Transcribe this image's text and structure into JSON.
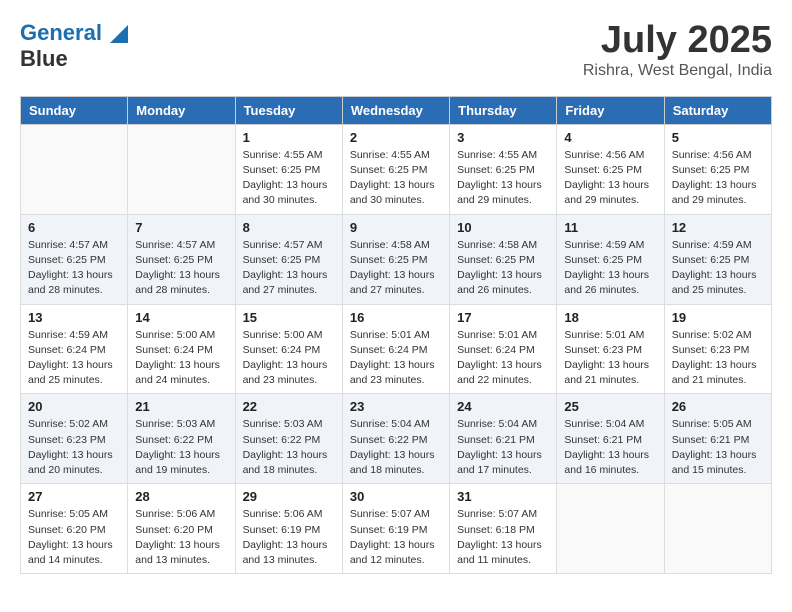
{
  "header": {
    "logo_line1": "General",
    "logo_line2": "Blue",
    "month_year": "July 2025",
    "location": "Rishra, West Bengal, India"
  },
  "weekdays": [
    "Sunday",
    "Monday",
    "Tuesday",
    "Wednesday",
    "Thursday",
    "Friday",
    "Saturday"
  ],
  "weeks": [
    [
      {
        "day": "",
        "info": ""
      },
      {
        "day": "",
        "info": ""
      },
      {
        "day": "1",
        "info": "Sunrise: 4:55 AM\nSunset: 6:25 PM\nDaylight: 13 hours and 30 minutes."
      },
      {
        "day": "2",
        "info": "Sunrise: 4:55 AM\nSunset: 6:25 PM\nDaylight: 13 hours and 30 minutes."
      },
      {
        "day": "3",
        "info": "Sunrise: 4:55 AM\nSunset: 6:25 PM\nDaylight: 13 hours and 29 minutes."
      },
      {
        "day": "4",
        "info": "Sunrise: 4:56 AM\nSunset: 6:25 PM\nDaylight: 13 hours and 29 minutes."
      },
      {
        "day": "5",
        "info": "Sunrise: 4:56 AM\nSunset: 6:25 PM\nDaylight: 13 hours and 29 minutes."
      }
    ],
    [
      {
        "day": "6",
        "info": "Sunrise: 4:57 AM\nSunset: 6:25 PM\nDaylight: 13 hours and 28 minutes."
      },
      {
        "day": "7",
        "info": "Sunrise: 4:57 AM\nSunset: 6:25 PM\nDaylight: 13 hours and 28 minutes."
      },
      {
        "day": "8",
        "info": "Sunrise: 4:57 AM\nSunset: 6:25 PM\nDaylight: 13 hours and 27 minutes."
      },
      {
        "day": "9",
        "info": "Sunrise: 4:58 AM\nSunset: 6:25 PM\nDaylight: 13 hours and 27 minutes."
      },
      {
        "day": "10",
        "info": "Sunrise: 4:58 AM\nSunset: 6:25 PM\nDaylight: 13 hours and 26 minutes."
      },
      {
        "day": "11",
        "info": "Sunrise: 4:59 AM\nSunset: 6:25 PM\nDaylight: 13 hours and 26 minutes."
      },
      {
        "day": "12",
        "info": "Sunrise: 4:59 AM\nSunset: 6:25 PM\nDaylight: 13 hours and 25 minutes."
      }
    ],
    [
      {
        "day": "13",
        "info": "Sunrise: 4:59 AM\nSunset: 6:24 PM\nDaylight: 13 hours and 25 minutes."
      },
      {
        "day": "14",
        "info": "Sunrise: 5:00 AM\nSunset: 6:24 PM\nDaylight: 13 hours and 24 minutes."
      },
      {
        "day": "15",
        "info": "Sunrise: 5:00 AM\nSunset: 6:24 PM\nDaylight: 13 hours and 23 minutes."
      },
      {
        "day": "16",
        "info": "Sunrise: 5:01 AM\nSunset: 6:24 PM\nDaylight: 13 hours and 23 minutes."
      },
      {
        "day": "17",
        "info": "Sunrise: 5:01 AM\nSunset: 6:24 PM\nDaylight: 13 hours and 22 minutes."
      },
      {
        "day": "18",
        "info": "Sunrise: 5:01 AM\nSunset: 6:23 PM\nDaylight: 13 hours and 21 minutes."
      },
      {
        "day": "19",
        "info": "Sunrise: 5:02 AM\nSunset: 6:23 PM\nDaylight: 13 hours and 21 minutes."
      }
    ],
    [
      {
        "day": "20",
        "info": "Sunrise: 5:02 AM\nSunset: 6:23 PM\nDaylight: 13 hours and 20 minutes."
      },
      {
        "day": "21",
        "info": "Sunrise: 5:03 AM\nSunset: 6:22 PM\nDaylight: 13 hours and 19 minutes."
      },
      {
        "day": "22",
        "info": "Sunrise: 5:03 AM\nSunset: 6:22 PM\nDaylight: 13 hours and 18 minutes."
      },
      {
        "day": "23",
        "info": "Sunrise: 5:04 AM\nSunset: 6:22 PM\nDaylight: 13 hours and 18 minutes."
      },
      {
        "day": "24",
        "info": "Sunrise: 5:04 AM\nSunset: 6:21 PM\nDaylight: 13 hours and 17 minutes."
      },
      {
        "day": "25",
        "info": "Sunrise: 5:04 AM\nSunset: 6:21 PM\nDaylight: 13 hours and 16 minutes."
      },
      {
        "day": "26",
        "info": "Sunrise: 5:05 AM\nSunset: 6:21 PM\nDaylight: 13 hours and 15 minutes."
      }
    ],
    [
      {
        "day": "27",
        "info": "Sunrise: 5:05 AM\nSunset: 6:20 PM\nDaylight: 13 hours and 14 minutes."
      },
      {
        "day": "28",
        "info": "Sunrise: 5:06 AM\nSunset: 6:20 PM\nDaylight: 13 hours and 13 minutes."
      },
      {
        "day": "29",
        "info": "Sunrise: 5:06 AM\nSunset: 6:19 PM\nDaylight: 13 hours and 13 minutes."
      },
      {
        "day": "30",
        "info": "Sunrise: 5:07 AM\nSunset: 6:19 PM\nDaylight: 13 hours and 12 minutes."
      },
      {
        "day": "31",
        "info": "Sunrise: 5:07 AM\nSunset: 6:18 PM\nDaylight: 13 hours and 11 minutes."
      },
      {
        "day": "",
        "info": ""
      },
      {
        "day": "",
        "info": ""
      }
    ]
  ]
}
